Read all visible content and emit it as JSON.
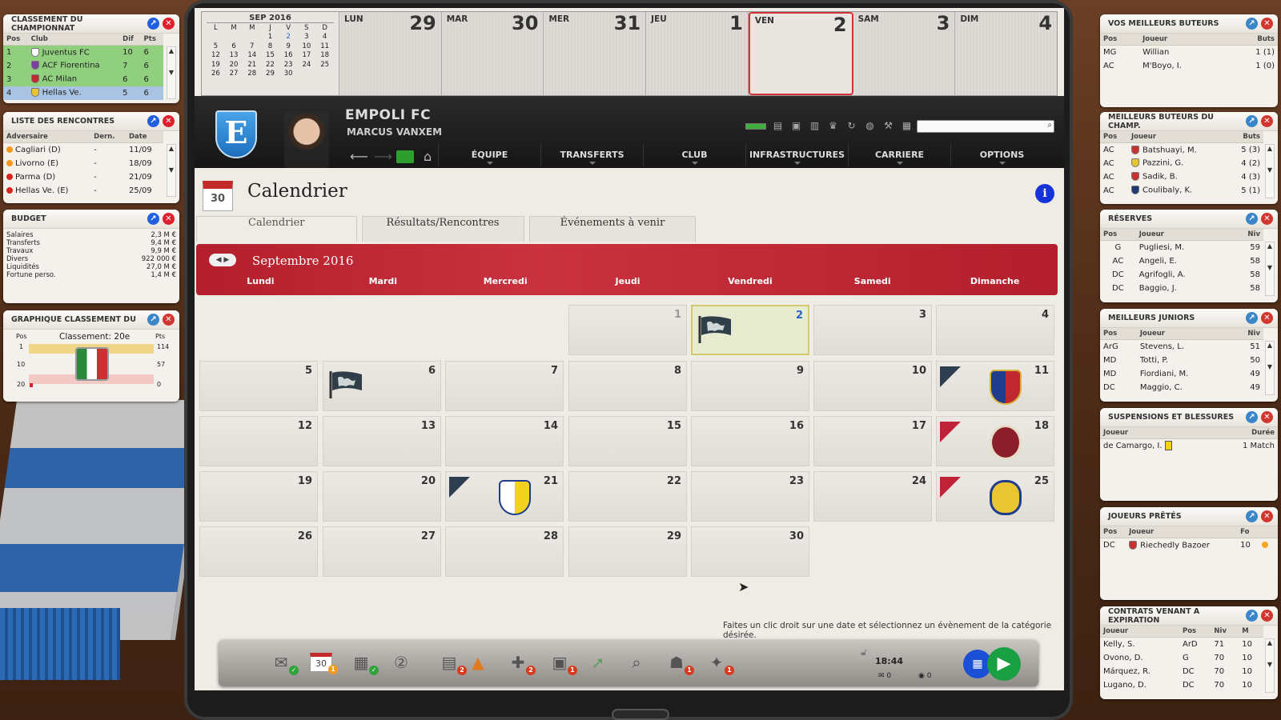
{
  "left": {
    "classement": {
      "title": "CLASSEMENT DU CHAMPIONNAT",
      "cols": [
        "Pos",
        "Club",
        "Dif",
        "Pts"
      ],
      "rows": [
        [
          "1",
          "Juventus FC",
          "10",
          "6"
        ],
        [
          "2",
          "ACF Fiorentina",
          "7",
          "6"
        ],
        [
          "3",
          "AC Milan",
          "6",
          "6"
        ],
        [
          "4",
          "Hellas Ve.",
          "5",
          "6"
        ]
      ]
    },
    "rencontres": {
      "title": "LISTE DES RENCONTRES",
      "cols": [
        "Adversaire",
        "Dern.",
        "Date"
      ],
      "rows": [
        [
          "Cagliari (D)",
          "-",
          "11/09"
        ],
        [
          "Livorno (E)",
          "-",
          "18/09"
        ],
        [
          "Parma (D)",
          "-",
          "21/09"
        ],
        [
          "Hellas Ve. (E)",
          "-",
          "25/09"
        ]
      ]
    },
    "budget": {
      "title": "BUDGET",
      "rows": [
        [
          "Salaires",
          "2,3 M €"
        ],
        [
          "Transferts",
          "9,4 M €"
        ],
        [
          "Travaux",
          "9,9 M €"
        ],
        [
          "Divers",
          "922 000 €"
        ],
        [
          "Liquidités",
          "27,0 M €"
        ],
        [
          "Fortune perso.",
          "1,4 M €"
        ]
      ]
    },
    "graph": {
      "title": "GRAPHIQUE CLASSEMENT DU",
      "pos": "Pos",
      "pts": "Pts",
      "label": "Classement: 20e",
      "ticks_pos": [
        "1",
        "10",
        "20"
      ],
      "ticks_pts": [
        "114",
        "57",
        "0"
      ]
    }
  },
  "right": {
    "buteurs": {
      "title": "VOS MEILLEURS BUTEURS",
      "cols": [
        "Pos",
        "Joueur",
        "Buts"
      ],
      "rows": [
        [
          "MG",
          "Willian",
          "1 (1)"
        ],
        [
          "AC",
          "M'Boyo, I.",
          "1 (0)"
        ]
      ]
    },
    "buteurs_champ": {
      "title": "MEILLEURS BUTEURS DU CHAMP.",
      "cols": [
        "Pos",
        "Joueur",
        "Buts"
      ],
      "rows": [
        [
          "AC",
          "Batshuayi, M.",
          "5 (3)"
        ],
        [
          "AC",
          "Pazzini, G.",
          "4 (2)"
        ],
        [
          "AC",
          "Sadik, B.",
          "4 (3)"
        ],
        [
          "AC",
          "Coulibaly, K.",
          "5 (1)"
        ]
      ]
    },
    "reserves": {
      "title": "RÉSERVES",
      "cols": [
        "Pos",
        "Joueur",
        "Niv"
      ],
      "rows": [
        [
          "G",
          "Pugliesi, M.",
          "59"
        ],
        [
          "AC",
          "Angeli, E.",
          "58"
        ],
        [
          "DC",
          "Agrifogli, A.",
          "58"
        ],
        [
          "DC",
          "Baggio, J.",
          "58"
        ]
      ]
    },
    "juniors": {
      "title": "MEILLEURS JUNIORS",
      "cols": [
        "Pos",
        "Joueur",
        "Niv"
      ],
      "rows": [
        [
          "ArG",
          "Stevens, L.",
          "51"
        ],
        [
          "MD",
          "Totti, P.",
          "50"
        ],
        [
          "MD",
          "Fiordiani, M.",
          "49"
        ],
        [
          "DC",
          "Maggio, C.",
          "49"
        ]
      ]
    },
    "susp": {
      "title": "SUSPENSIONS ET BLESSURES",
      "cols": [
        "Joueur",
        "Durée"
      ],
      "rows": [
        [
          "de Camargo, I.",
          "1 Match"
        ]
      ]
    },
    "pretes": {
      "title": "JOUEURS PRÊTÉS",
      "cols": [
        "Pos",
        "Joueur",
        "Fo"
      ],
      "rows": [
        [
          "DC",
          "Riechedly Bazoer",
          "10"
        ]
      ]
    },
    "contrats": {
      "title": "CONTRATS VENANT A EXPIRATION",
      "cols": [
        "Joueur",
        "Pos",
        "Niv",
        "M"
      ],
      "rows": [
        [
          "Kelly, S.",
          "ArD",
          "71",
          "10"
        ],
        [
          "Ovono, D.",
          "G",
          "70",
          "10"
        ],
        [
          "Márquez, R.",
          "DC",
          "70",
          "10"
        ],
        [
          "Lugano, D.",
          "DC",
          "70",
          "10"
        ]
      ]
    }
  },
  "strip": {
    "minical": {
      "title": "SEP 2016",
      "head": [
        "L",
        "M",
        "M",
        "J",
        "V",
        "S",
        "D"
      ],
      "weeks": [
        [
          "",
          "",
          "",
          "1",
          "2",
          "3",
          "4"
        ],
        [
          "5",
          "6",
          "7",
          "8",
          "9",
          "10",
          "11"
        ],
        [
          "12",
          "13",
          "14",
          "15",
          "16",
          "17",
          "18"
        ],
        [
          "19",
          "20",
          "21",
          "22",
          "23",
          "24",
          "25"
        ],
        [
          "26",
          "27",
          "28",
          "29",
          "30",
          "",
          ""
        ]
      ]
    },
    "days": [
      [
        "LUN",
        "29"
      ],
      [
        "MAR",
        "30"
      ],
      [
        "MER",
        "31"
      ],
      [
        "JEU",
        "1"
      ],
      [
        "VEN",
        "2"
      ],
      [
        "SAM",
        "3"
      ],
      [
        "DIM",
        "4"
      ]
    ]
  },
  "header": {
    "club": "EMPOLI FC",
    "manager": "MARCUS VANXEM",
    "logo_letter": "E",
    "menu": [
      "ÉQUIPE",
      "TRANSFERTS",
      "CLUB",
      "INFRASTRUCTURES",
      "CARRIERE",
      "OPTIONS"
    ]
  },
  "page": {
    "icon_day": "30",
    "title": "Calendrier",
    "tabs": [
      "Calendrier",
      "Résultats/Rencontres",
      "Événements à venir"
    ],
    "month": "Septembre 2016",
    "weekdays": [
      "Lundi",
      "Mardi",
      "Mercredi",
      "Jeudi",
      "Vendredi",
      "Samedi",
      "Dimanche"
    ],
    "hint": "Faites un clic droit sur une date et sélectionnez un évènement de la catégorie désirée."
  },
  "dock": {
    "time": "18:44",
    "mail": "0",
    "msg": "0",
    "cal_icon": "30"
  }
}
